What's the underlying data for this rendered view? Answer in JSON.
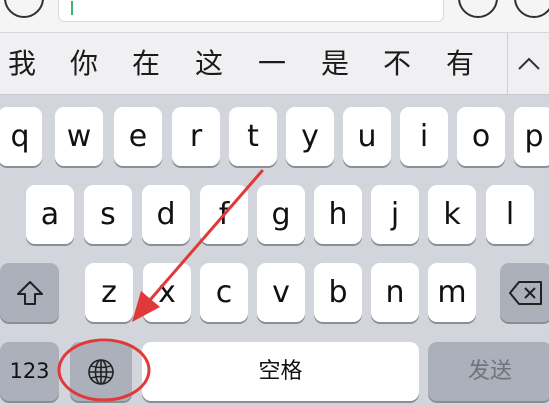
{
  "candidates": [
    "我",
    "你",
    "在",
    "这",
    "一",
    "是",
    "不",
    "有"
  ],
  "keyboard": {
    "row1": [
      "q",
      "w",
      "e",
      "r",
      "t",
      "y",
      "u",
      "i",
      "o",
      "p"
    ],
    "row2": [
      "a",
      "s",
      "d",
      "f",
      "g",
      "h",
      "j",
      "k",
      "l"
    ],
    "row3": [
      "z",
      "x",
      "c",
      "v",
      "b",
      "n",
      "m"
    ],
    "numbers_label": "123",
    "space_label": "空格",
    "send_label": "发送"
  },
  "colors": {
    "keyboard_bg": "#d2d5db",
    "key": "#ffffff",
    "function_key": "#abb0ba",
    "annotation": "#e0393a"
  },
  "icons": [
    "plus-circle-icon",
    "emoji-icon",
    "chevron-up-icon",
    "shift-icon",
    "backspace-icon",
    "globe-icon"
  ]
}
